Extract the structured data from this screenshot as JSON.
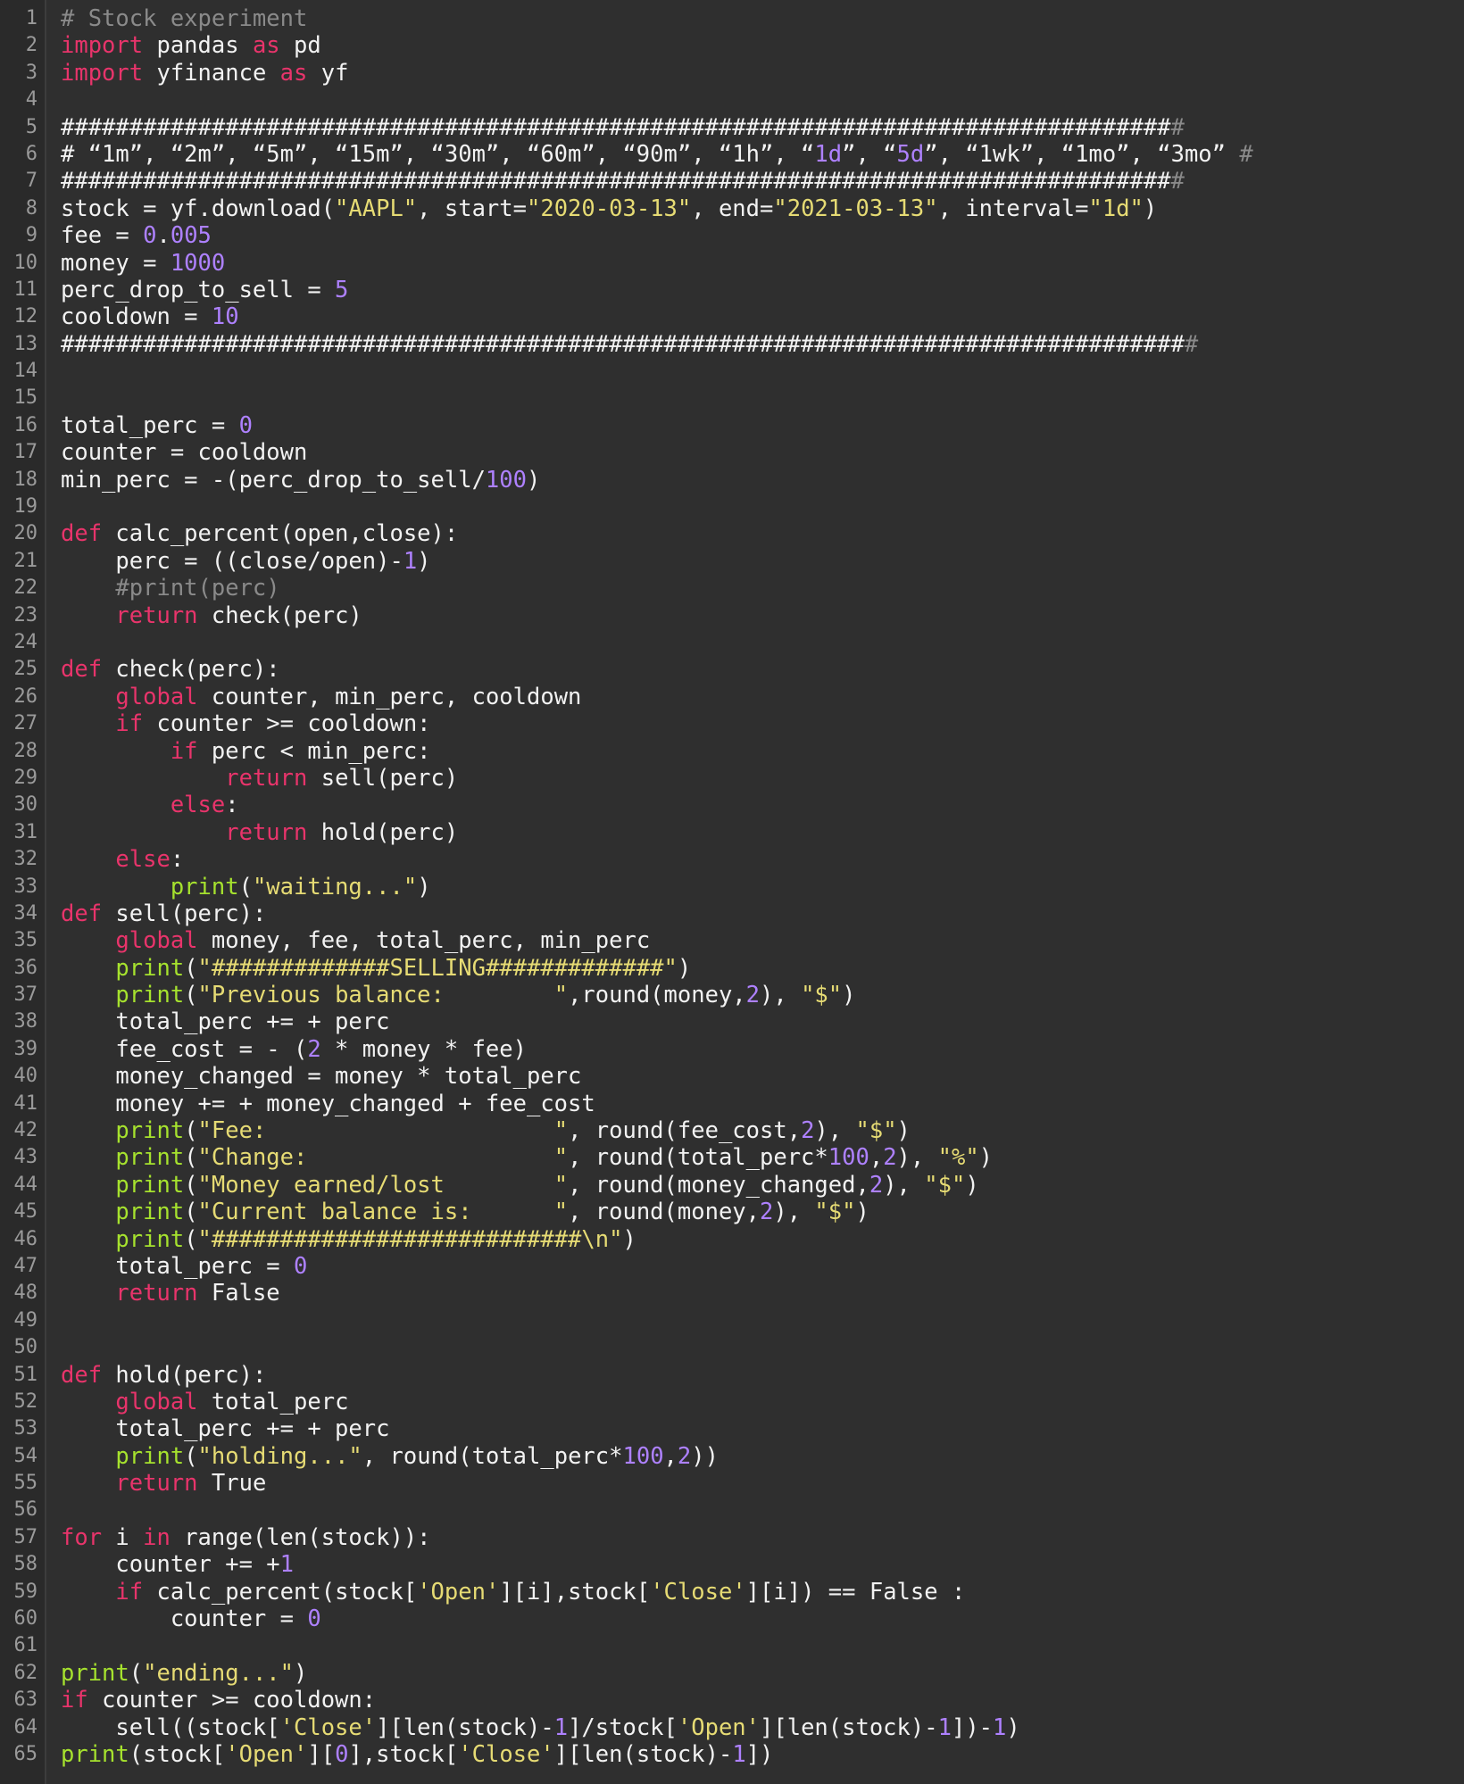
{
  "editor": {
    "language": "python",
    "colors": {
      "background": "#2f2f2f",
      "gutter": "#2a2a2a",
      "line_number": "#9a9a9a",
      "text": "#f2f2f2",
      "keyword": "#e8346b",
      "string": "#e6db74",
      "number": "#ae81ff",
      "comment": "#8a8a8a",
      "builtin_function": "#a6e22e"
    },
    "lines": [
      {
        "n": "1",
        "tokens": [
          [
            "cmt",
            "# Stock experiment"
          ]
        ]
      },
      {
        "n": "2",
        "tokens": [
          [
            "kw",
            "import"
          ],
          [
            "t",
            " pandas "
          ],
          [
            "kw",
            "as"
          ],
          [
            "t",
            " pd"
          ]
        ]
      },
      {
        "n": "3",
        "tokens": [
          [
            "kw",
            "import"
          ],
          [
            "t",
            " yfinance "
          ],
          [
            "kw",
            "as"
          ],
          [
            "t",
            " yf"
          ]
        ]
      },
      {
        "n": "4",
        "tokens": []
      },
      {
        "n": "5",
        "tokens": [
          [
            "t",
            "#################################################################################"
          ],
          [
            "cmt",
            "#"
          ]
        ]
      },
      {
        "n": "6",
        "tokens": [
          [
            "t",
            "# “1m”, “2m”, “5m”, “15m”, “30m”, “60m”, “90m”, “1h”, “"
          ],
          [
            "num",
            "1d"
          ],
          [
            "t",
            "”, “"
          ],
          [
            "num",
            "5d"
          ],
          [
            "t",
            "”, “1wk”, “1mo”, “3mo” "
          ],
          [
            "cmt",
            "#"
          ]
        ]
      },
      {
        "n": "7",
        "tokens": [
          [
            "t",
            "#################################################################################"
          ],
          [
            "cmt",
            "#"
          ]
        ]
      },
      {
        "n": "8",
        "tokens": [
          [
            "t",
            "stock = yf.download("
          ],
          [
            "str",
            "\"AAPL\""
          ],
          [
            "t",
            ", start="
          ],
          [
            "str",
            "\"2020-03-13\""
          ],
          [
            "t",
            ", end="
          ],
          [
            "str",
            "\"2021-03-13\""
          ],
          [
            "t",
            ", interval="
          ],
          [
            "str",
            "\"1d\""
          ],
          [
            "t",
            ")"
          ]
        ]
      },
      {
        "n": "9",
        "tokens": [
          [
            "t",
            "fee = "
          ],
          [
            "num",
            "0"
          ],
          [
            "t",
            "."
          ],
          [
            "num",
            "005"
          ]
        ]
      },
      {
        "n": "10",
        "tokens": [
          [
            "t",
            "money = "
          ],
          [
            "num",
            "1000"
          ]
        ]
      },
      {
        "n": "11",
        "tokens": [
          [
            "t",
            "perc_drop_to_sell = "
          ],
          [
            "num",
            "5"
          ]
        ]
      },
      {
        "n": "12",
        "tokens": [
          [
            "t",
            "cooldown = "
          ],
          [
            "num",
            "10"
          ]
        ]
      },
      {
        "n": "13",
        "tokens": [
          [
            "t",
            "##################################################################################"
          ],
          [
            "cmt",
            "#"
          ]
        ]
      },
      {
        "n": "14",
        "tokens": []
      },
      {
        "n": "15",
        "tokens": []
      },
      {
        "n": "16",
        "tokens": [
          [
            "t",
            "total_perc = "
          ],
          [
            "num",
            "0"
          ]
        ]
      },
      {
        "n": "17",
        "tokens": [
          [
            "t",
            "counter = cooldown"
          ]
        ]
      },
      {
        "n": "18",
        "tokens": [
          [
            "t",
            "min_perc = -(perc_drop_to_sell/"
          ],
          [
            "num",
            "100"
          ],
          [
            "t",
            ")"
          ]
        ]
      },
      {
        "n": "19",
        "tokens": []
      },
      {
        "n": "20",
        "tokens": [
          [
            "kw",
            "def"
          ],
          [
            "t",
            " calc_percent(open,close):"
          ]
        ]
      },
      {
        "n": "21",
        "tokens": [
          [
            "t",
            "    perc = ((close/open)-"
          ],
          [
            "num",
            "1"
          ],
          [
            "t",
            ")"
          ]
        ]
      },
      {
        "n": "22",
        "tokens": [
          [
            "cmt",
            "    #print(perc)"
          ]
        ]
      },
      {
        "n": "23",
        "tokens": [
          [
            "t",
            "    "
          ],
          [
            "kw",
            "return"
          ],
          [
            "t",
            " check(perc)"
          ]
        ]
      },
      {
        "n": "24",
        "tokens": []
      },
      {
        "n": "25",
        "tokens": [
          [
            "kw",
            "def"
          ],
          [
            "t",
            " check(perc):"
          ]
        ]
      },
      {
        "n": "26",
        "tokens": [
          [
            "t",
            "    "
          ],
          [
            "kw",
            "global"
          ],
          [
            "t",
            " counter, min_perc, cooldown"
          ]
        ]
      },
      {
        "n": "27",
        "tokens": [
          [
            "t",
            "    "
          ],
          [
            "kw",
            "if"
          ],
          [
            "t",
            " counter >= cooldown:"
          ]
        ]
      },
      {
        "n": "28",
        "tokens": [
          [
            "t",
            "        "
          ],
          [
            "kw",
            "if"
          ],
          [
            "t",
            " perc < min_perc:"
          ]
        ]
      },
      {
        "n": "29",
        "tokens": [
          [
            "t",
            "            "
          ],
          [
            "kw",
            "return"
          ],
          [
            "t",
            " sell(perc)"
          ]
        ]
      },
      {
        "n": "30",
        "tokens": [
          [
            "t",
            "        "
          ],
          [
            "kw",
            "else"
          ],
          [
            "t",
            ":"
          ]
        ]
      },
      {
        "n": "31",
        "tokens": [
          [
            "t",
            "            "
          ],
          [
            "kw",
            "return"
          ],
          [
            "t",
            " hold(perc)"
          ]
        ]
      },
      {
        "n": "32",
        "tokens": [
          [
            "t",
            "    "
          ],
          [
            "kw",
            "else"
          ],
          [
            "t",
            ":"
          ]
        ]
      },
      {
        "n": "33",
        "tokens": [
          [
            "t",
            "        "
          ],
          [
            "fn",
            "print"
          ],
          [
            "t",
            "("
          ],
          [
            "str",
            "\"waiting...\""
          ],
          [
            "t",
            ")"
          ]
        ]
      },
      {
        "n": "34",
        "tokens": [
          [
            "kw",
            "def"
          ],
          [
            "t",
            " sell(perc):"
          ]
        ]
      },
      {
        "n": "35",
        "tokens": [
          [
            "t",
            "    "
          ],
          [
            "kw",
            "global"
          ],
          [
            "t",
            " money, fee, total_perc, min_perc"
          ]
        ]
      },
      {
        "n": "36",
        "tokens": [
          [
            "t",
            "    "
          ],
          [
            "fn",
            "print"
          ],
          [
            "t",
            "("
          ],
          [
            "str",
            "\"#############SELLING#############\""
          ],
          [
            "t",
            ")"
          ]
        ]
      },
      {
        "n": "37",
        "tokens": [
          [
            "t",
            "    "
          ],
          [
            "fn",
            "print"
          ],
          [
            "t",
            "("
          ],
          [
            "str",
            "\"Previous balance:        \""
          ],
          [
            "t",
            ",round(money,"
          ],
          [
            "num",
            "2"
          ],
          [
            "t",
            "), "
          ],
          [
            "str",
            "\"$\""
          ],
          [
            "t",
            ")"
          ]
        ]
      },
      {
        "n": "38",
        "tokens": [
          [
            "t",
            "    total_perc += + perc"
          ]
        ]
      },
      {
        "n": "39",
        "tokens": [
          [
            "t",
            "    fee_cost = - ("
          ],
          [
            "num",
            "2"
          ],
          [
            "t",
            " * money * fee)"
          ]
        ]
      },
      {
        "n": "40",
        "tokens": [
          [
            "t",
            "    money_changed = money * total_perc"
          ]
        ]
      },
      {
        "n": "41",
        "tokens": [
          [
            "t",
            "    money += + money_changed + fee_cost"
          ]
        ]
      },
      {
        "n": "42",
        "tokens": [
          [
            "t",
            "    "
          ],
          [
            "fn",
            "print"
          ],
          [
            "t",
            "("
          ],
          [
            "str",
            "\"Fee:                     \""
          ],
          [
            "t",
            ", round(fee_cost,"
          ],
          [
            "num",
            "2"
          ],
          [
            "t",
            "), "
          ],
          [
            "str",
            "\"$\""
          ],
          [
            "t",
            ")"
          ]
        ]
      },
      {
        "n": "43",
        "tokens": [
          [
            "t",
            "    "
          ],
          [
            "fn",
            "print"
          ],
          [
            "t",
            "("
          ],
          [
            "str",
            "\"Change:                  \""
          ],
          [
            "t",
            ", round(total_perc*"
          ],
          [
            "num",
            "100"
          ],
          [
            "t",
            ","
          ],
          [
            "num",
            "2"
          ],
          [
            "t",
            "), "
          ],
          [
            "str",
            "\"%\""
          ],
          [
            "t",
            ")"
          ]
        ]
      },
      {
        "n": "44",
        "tokens": [
          [
            "t",
            "    "
          ],
          [
            "fn",
            "print"
          ],
          [
            "t",
            "("
          ],
          [
            "str",
            "\"Money earned/lost        \""
          ],
          [
            "t",
            ", round(money_changed,"
          ],
          [
            "num",
            "2"
          ],
          [
            "t",
            "), "
          ],
          [
            "str",
            "\"$\""
          ],
          [
            "t",
            ")"
          ]
        ]
      },
      {
        "n": "45",
        "tokens": [
          [
            "t",
            "    "
          ],
          [
            "fn",
            "print"
          ],
          [
            "t",
            "("
          ],
          [
            "str",
            "\"Current balance is:      \""
          ],
          [
            "t",
            ", round(money,"
          ],
          [
            "num",
            "2"
          ],
          [
            "t",
            "), "
          ],
          [
            "str",
            "\"$\""
          ],
          [
            "t",
            ")"
          ]
        ]
      },
      {
        "n": "46",
        "tokens": [
          [
            "t",
            "    "
          ],
          [
            "fn",
            "print"
          ],
          [
            "t",
            "("
          ],
          [
            "str",
            "\"###########################\\n\""
          ],
          [
            "t",
            ")"
          ]
        ]
      },
      {
        "n": "47",
        "tokens": [
          [
            "t",
            "    total_perc = "
          ],
          [
            "num",
            "0"
          ]
        ]
      },
      {
        "n": "48",
        "tokens": [
          [
            "t",
            "    "
          ],
          [
            "kw",
            "return"
          ],
          [
            "t",
            " False"
          ]
        ]
      },
      {
        "n": "49",
        "tokens": []
      },
      {
        "n": "50",
        "tokens": []
      },
      {
        "n": "51",
        "tokens": [
          [
            "kw",
            "def"
          ],
          [
            "t",
            " hold(perc):"
          ]
        ]
      },
      {
        "n": "52",
        "tokens": [
          [
            "t",
            "    "
          ],
          [
            "kw",
            "global"
          ],
          [
            "t",
            " total_perc"
          ]
        ]
      },
      {
        "n": "53",
        "tokens": [
          [
            "t",
            "    total_perc += + perc"
          ]
        ]
      },
      {
        "n": "54",
        "tokens": [
          [
            "t",
            "    "
          ],
          [
            "fn",
            "print"
          ],
          [
            "t",
            "("
          ],
          [
            "str",
            "\"holding...\""
          ],
          [
            "t",
            ", round(total_perc*"
          ],
          [
            "num",
            "100"
          ],
          [
            "t",
            ","
          ],
          [
            "num",
            "2"
          ],
          [
            "t",
            "))"
          ]
        ]
      },
      {
        "n": "55",
        "tokens": [
          [
            "t",
            "    "
          ],
          [
            "kw",
            "return"
          ],
          [
            "t",
            " True"
          ]
        ]
      },
      {
        "n": "56",
        "tokens": []
      },
      {
        "n": "57",
        "tokens": [
          [
            "kw",
            "for"
          ],
          [
            "t",
            " i "
          ],
          [
            "kw",
            "in"
          ],
          [
            "t",
            " range(len(stock)):"
          ]
        ]
      },
      {
        "n": "58",
        "tokens": [
          [
            "t",
            "    counter += +"
          ],
          [
            "num",
            "1"
          ]
        ]
      },
      {
        "n": "59",
        "tokens": [
          [
            "t",
            "    "
          ],
          [
            "kw",
            "if"
          ],
          [
            "t",
            " calc_percent(stock["
          ],
          [
            "str",
            "'Open'"
          ],
          [
            "t",
            "][i],stock["
          ],
          [
            "str",
            "'Close'"
          ],
          [
            "t",
            "][i]) == False :"
          ]
        ]
      },
      {
        "n": "60",
        "tokens": [
          [
            "t",
            "        counter = "
          ],
          [
            "num",
            "0"
          ]
        ]
      },
      {
        "n": "61",
        "tokens": []
      },
      {
        "n": "62",
        "tokens": [
          [
            "fn",
            "print"
          ],
          [
            "t",
            "("
          ],
          [
            "str",
            "\"ending...\""
          ],
          [
            "t",
            ")"
          ]
        ]
      },
      {
        "n": "63",
        "tokens": [
          [
            "kw",
            "if"
          ],
          [
            "t",
            " counter >= cooldown:"
          ]
        ]
      },
      {
        "n": "64",
        "tokens": [
          [
            "t",
            "    sell((stock["
          ],
          [
            "str",
            "'Close'"
          ],
          [
            "t",
            "][len(stock)-"
          ],
          [
            "num",
            "1"
          ],
          [
            "t",
            "]/stock["
          ],
          [
            "str",
            "'Open'"
          ],
          [
            "t",
            "][len(stock)-"
          ],
          [
            "num",
            "1"
          ],
          [
            "t",
            "])-"
          ],
          [
            "num",
            "1"
          ],
          [
            "t",
            ")"
          ]
        ]
      },
      {
        "n": "65",
        "tokens": [
          [
            "fn",
            "print"
          ],
          [
            "t",
            "(stock["
          ],
          [
            "str",
            "'Open'"
          ],
          [
            "t",
            "]["
          ],
          [
            "num",
            "0"
          ],
          [
            "t",
            "],stock["
          ],
          [
            "str",
            "'Close'"
          ],
          [
            "t",
            "][len(stock)-"
          ],
          [
            "num",
            "1"
          ],
          [
            "t",
            "])"
          ]
        ]
      }
    ]
  }
}
